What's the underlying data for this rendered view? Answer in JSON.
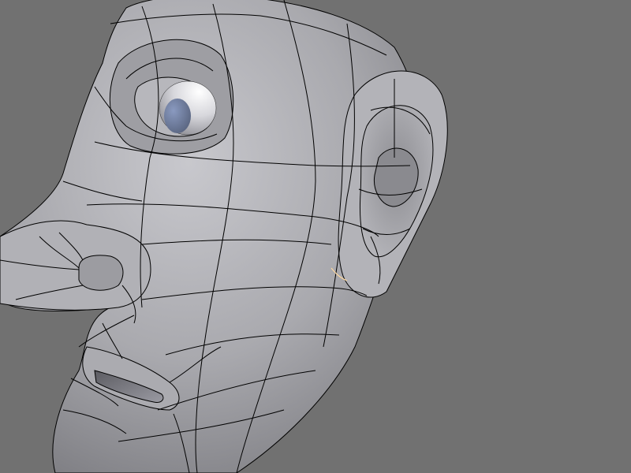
{
  "viewport": {
    "background_color": "#717171",
    "model_color": "#a8a8ad",
    "wire_color": "#000000",
    "eye_color": "#6b7a98"
  }
}
